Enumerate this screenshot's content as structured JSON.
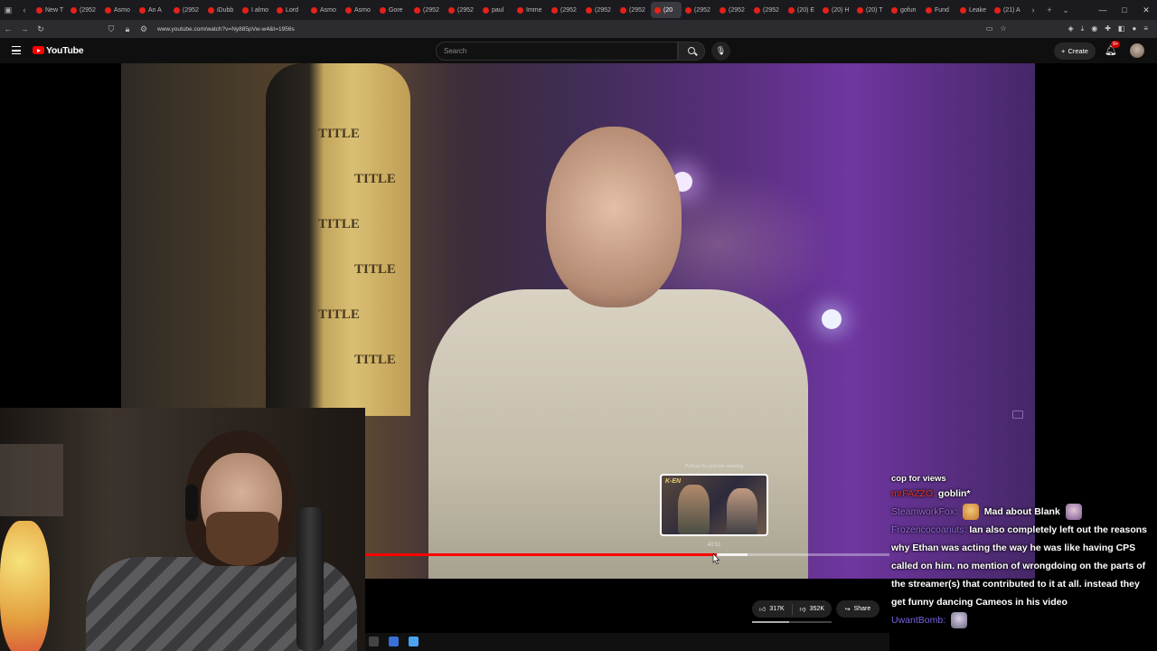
{
  "browser": {
    "tabs": [
      "New T",
      "(2952",
      "Asmo",
      "An A",
      "(2952",
      "iDubb",
      "I almo",
      "Lord",
      "Asmo",
      "Asmo",
      "Gore",
      "(2952",
      "(2952",
      "paul",
      "Imme",
      "(2952",
      "(2952",
      "(2952",
      "(20",
      "(2952",
      "(2952",
      "(2952",
      "(20) E",
      "(20) H",
      "(20) T",
      "gofun",
      "Fund",
      "Leake",
      "(21) A"
    ],
    "active_tab_index": 18,
    "url": "www.youtube.com/watch?v=Ny885pVw-w4&t=1956s"
  },
  "youtube": {
    "logo_text": "YouTube",
    "search_placeholder": "Search",
    "create_label": "Create",
    "notification_count": "9+"
  },
  "video": {
    "seek_tip": "Pull up for precise seeking",
    "seek_time": "40:51",
    "progress_played": 0.67,
    "progress_buffered": 0.73,
    "likes": "317K",
    "dislikes": "352K",
    "share_label": "Share",
    "like_ratio": 0.47
  },
  "chat": {
    "cut_line": "cop for views",
    "messages": [
      {
        "user": "mrFAZZO:",
        "user_color": "#e0372c",
        "text": "goblin*"
      },
      {
        "user": "SteamworkFox:",
        "user_color": "#9b6bd6",
        "text": "Mad about Blank"
      },
      {
        "user": "Frozencocoanuts:",
        "user_color": "#8e6ad8",
        "text": "Ian also completely left out the reasons why Ethan was acting the way he was like having CPS called on him. no mention of wrongdoing on the parts of the streamer(s) that contributed to it at all. instead they get funny dancing Cameos in his video"
      },
      {
        "user": "UwantBomb:",
        "user_color": "#7a62e0",
        "text": ""
      }
    ]
  },
  "icons": {
    "menu": "hamburger-icon",
    "search": "search-icon",
    "mic": "microphone-icon",
    "bell": "bell-icon",
    "like": "thumbs-up-icon",
    "dislike": "thumbs-down-icon",
    "share": "share-icon"
  }
}
